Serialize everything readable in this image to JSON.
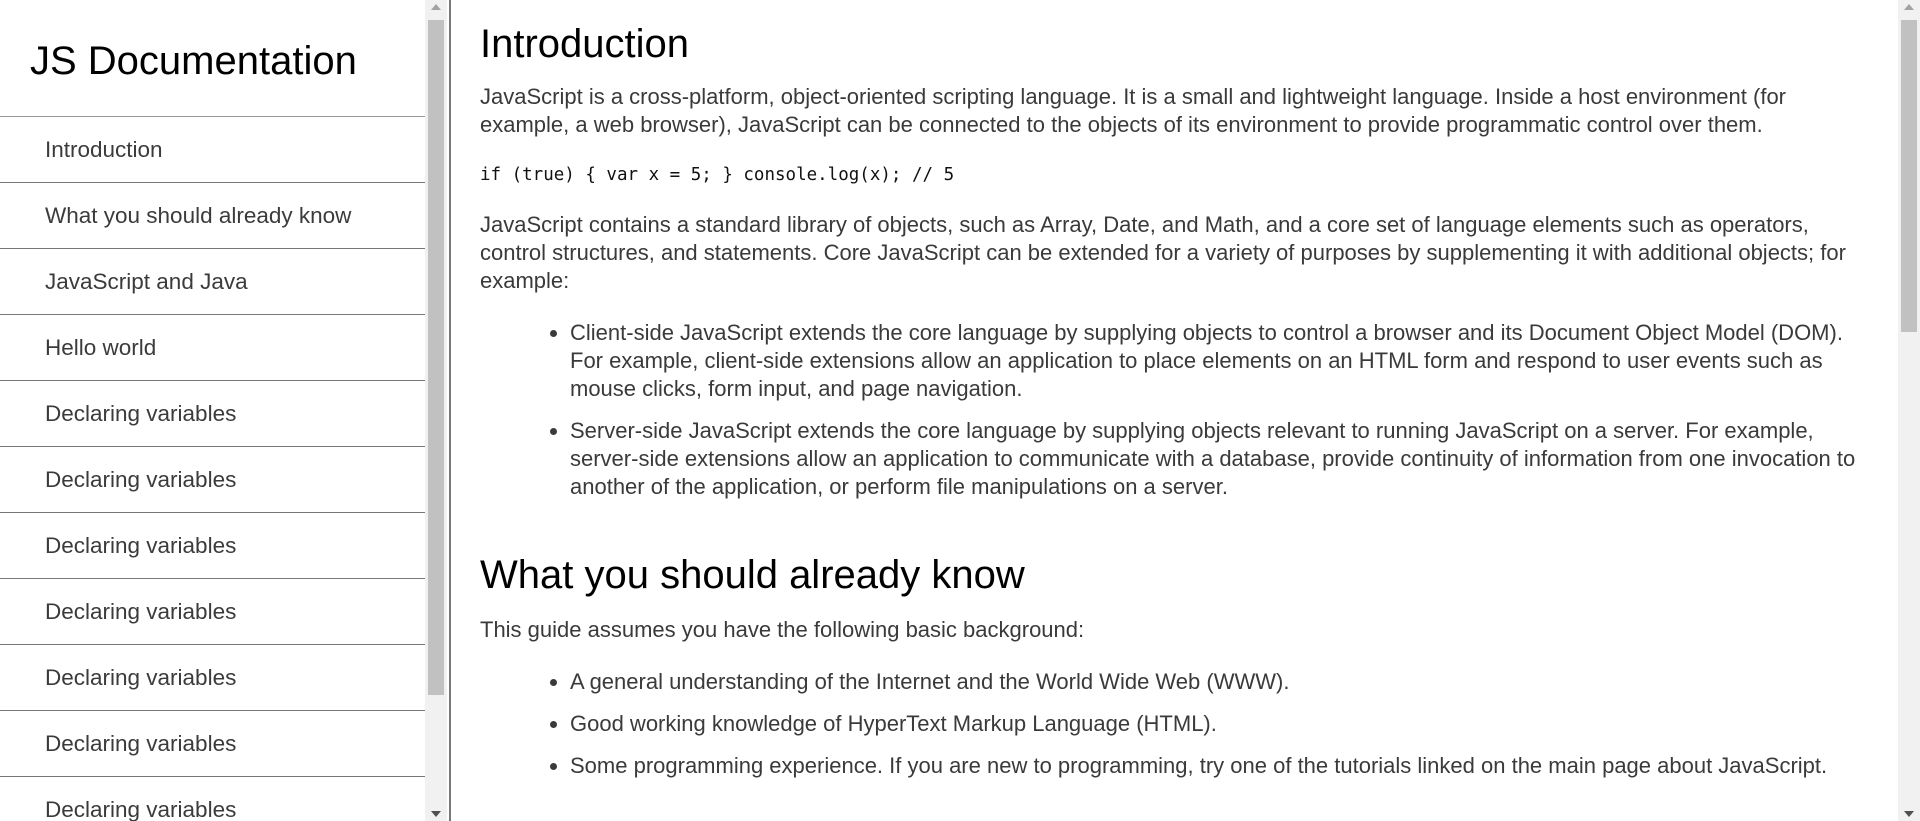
{
  "sidebar": {
    "title": "JS Documentation",
    "items": [
      {
        "label": "Introduction"
      },
      {
        "label": "What you should already know"
      },
      {
        "label": "JavaScript and Java"
      },
      {
        "label": "Hello world"
      },
      {
        "label": "Declaring variables"
      },
      {
        "label": "Declaring variables"
      },
      {
        "label": "Declaring variables"
      },
      {
        "label": "Declaring variables"
      },
      {
        "label": "Declaring variables"
      },
      {
        "label": "Declaring variables"
      },
      {
        "label": "Declaring variables"
      }
    ]
  },
  "main": {
    "section1": {
      "title": "Introduction",
      "p1": "JavaScript is a cross-platform, object-oriented scripting language. It is a small and lightweight language. Inside a host environment (for example, a web browser), JavaScript can be connected to the objects of its environment to provide programmatic control over them.",
      "code": "if (true) { var x = 5; } console.log(x); // 5",
      "p2": "JavaScript contains a standard library of objects, such as Array, Date, and Math, and a core set of language elements such as operators, control structures, and statements. Core JavaScript can be extended for a variety of purposes by supplementing it with additional objects; for example:",
      "bullets": [
        "Client-side JavaScript extends the core language by supplying objects to control a browser and its Document Object Model (DOM). For example, client-side extensions allow an application to place elements on an HTML form and respond to user events such as mouse clicks, form input, and page navigation.",
        "Server-side JavaScript extends the core language by supplying objects relevant to running JavaScript on a server. For example, server-side extensions allow an application to communicate with a database, provide continuity of information from one invocation to another of the application, or perform file manipulations on a server."
      ]
    },
    "section2": {
      "title": "What you should already know",
      "p1": "This guide assumes you have the following basic background:",
      "bullets": [
        "A general understanding of the Internet and the World Wide Web (WWW).",
        "Good working knowledge of HyperText Markup Language (HTML).",
        "Some programming experience. If you are new to programming, try one of the tutorials linked on the main page about JavaScript."
      ]
    }
  },
  "colors": {
    "sidebar_border": "#7a7a7a",
    "scrollbar_track": "#f1f1f1",
    "scrollbar_thumb": "#c1c1c1",
    "text": "#3a3a3a"
  }
}
